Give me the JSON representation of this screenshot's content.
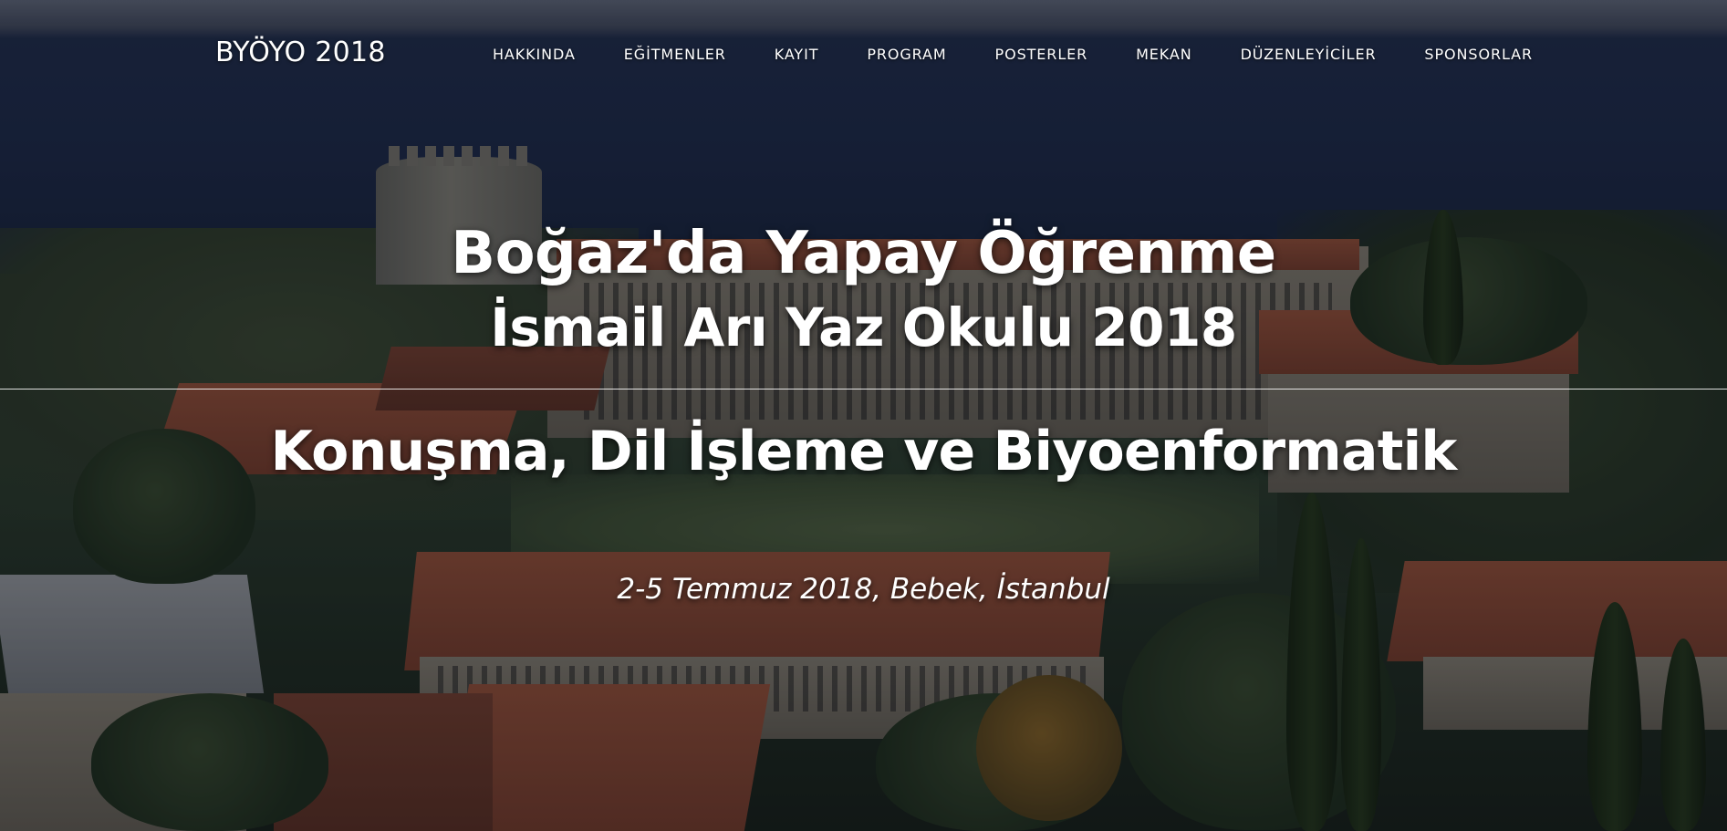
{
  "nav": {
    "brand": "BYÖYO 2018",
    "items": [
      {
        "label": "HAKKINDA"
      },
      {
        "label": "EĞİTMENLER"
      },
      {
        "label": "KAYIT"
      },
      {
        "label": "PROGRAM"
      },
      {
        "label": "POSTERLER"
      },
      {
        "label": "MEKAN"
      },
      {
        "label": "DÜZENLEYİCİLER"
      },
      {
        "label": "SPONSORLAR"
      }
    ]
  },
  "hero": {
    "title": "Boğaz'da Yapay Öğrenme",
    "subtitle": "İsmail Arı Yaz Okulu 2018",
    "topic": "Konuşma, Dil İşleme ve Biyoenformatik",
    "dateline": "2-5 Temmuz 2018, Bebek, İstanbul"
  },
  "colors": {
    "text": "#ffffff",
    "sea": "#1c2742",
    "roof": "#8a4a34",
    "foliage": "#243322"
  }
}
